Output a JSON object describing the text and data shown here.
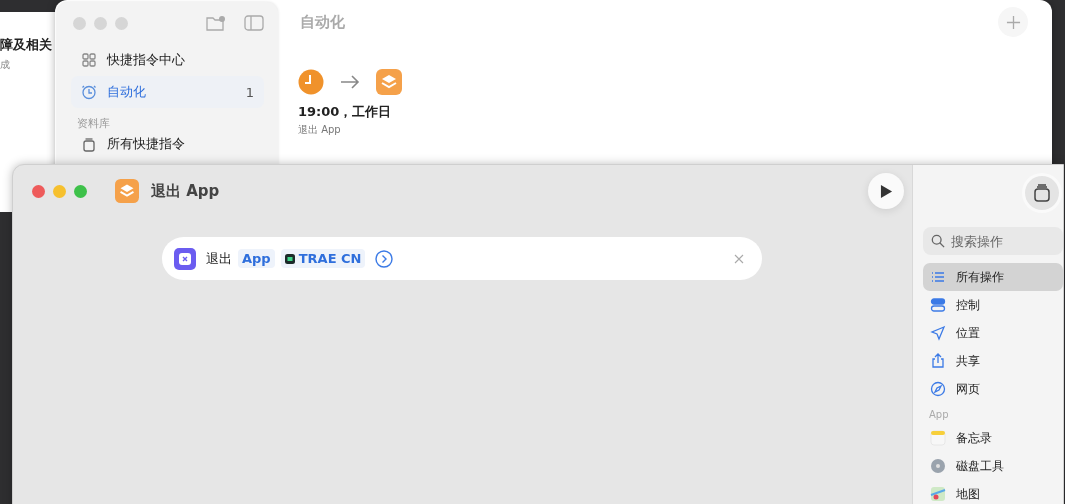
{
  "background_window": {
    "heading": "障及相关",
    "caption": "成"
  },
  "automation_window": {
    "title": "自动化",
    "sidebar": {
      "items": [
        {
          "label": "快捷指令中心",
          "selected": false
        },
        {
          "label": "自动化",
          "selected": true,
          "count": "1"
        }
      ],
      "section": "资料库",
      "library": [
        {
          "label": "所有快捷指令",
          "selected": false
        }
      ]
    },
    "automation": {
      "time": "19:00，工作日",
      "action": "退出 App"
    }
  },
  "editor_window": {
    "title": "退出 App",
    "action": {
      "verb": "退出",
      "params": [
        {
          "text": "App",
          "kind": "plain"
        },
        {
          "text": "TRAE CN",
          "kind": "app"
        }
      ]
    },
    "search": {
      "placeholder": "搜索操作"
    },
    "categories": [
      {
        "label": "所有操作",
        "selected": true
      },
      {
        "label": "控制",
        "selected": false
      },
      {
        "label": "位置",
        "selected": false
      },
      {
        "label": "共享",
        "selected": false
      },
      {
        "label": "网页",
        "selected": false
      }
    ],
    "apps_section": "App",
    "apps": [
      {
        "label": "备忘录"
      },
      {
        "label": "磁盘工具"
      },
      {
        "label": "地图"
      }
    ]
  }
}
